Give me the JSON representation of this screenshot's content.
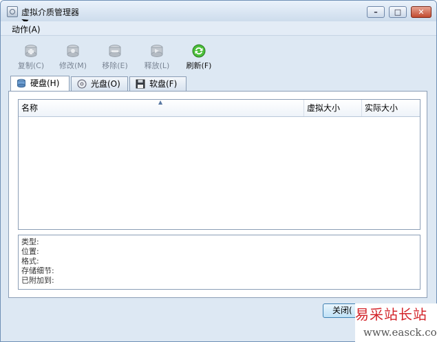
{
  "window": {
    "title": "虚拟介质管理器"
  },
  "menubar": {
    "actions_label": "动作(A)"
  },
  "toolbar": {
    "items": [
      {
        "label": "复制(C)",
        "icon": "disk-copy-icon",
        "enabled": false
      },
      {
        "label": "修改(M)",
        "icon": "disk-modify-icon",
        "enabled": false
      },
      {
        "label": "移除(E)",
        "icon": "disk-remove-icon",
        "enabled": false
      },
      {
        "label": "释放(L)",
        "icon": "disk-release-icon",
        "enabled": false
      },
      {
        "label": "刷新(F)",
        "icon": "refresh-icon",
        "enabled": true
      }
    ]
  },
  "tabs": [
    {
      "label": "硬盘(H)",
      "icon": "hard-disk-icon",
      "active": true
    },
    {
      "label": "光盘(O)",
      "icon": "optical-disc-icon",
      "active": false
    },
    {
      "label": "软盘(F)",
      "icon": "floppy-disk-icon",
      "active": false
    }
  ],
  "list": {
    "columns": [
      "名称",
      "虚拟大小",
      "实际大小"
    ],
    "rows": []
  },
  "details": {
    "fields": [
      "类型:",
      "位置:",
      "格式:",
      "存储细节:",
      "已附加到:"
    ]
  },
  "footer": {
    "close_label": "关闭("
  },
  "watermark": {
    "title": "易采站长站",
    "url": "www.easck.com"
  },
  "colors": {
    "refresh_green": "#2a9a2a",
    "disabled_gray": "#9aa3ad",
    "window_bg": "#dde8f3"
  }
}
